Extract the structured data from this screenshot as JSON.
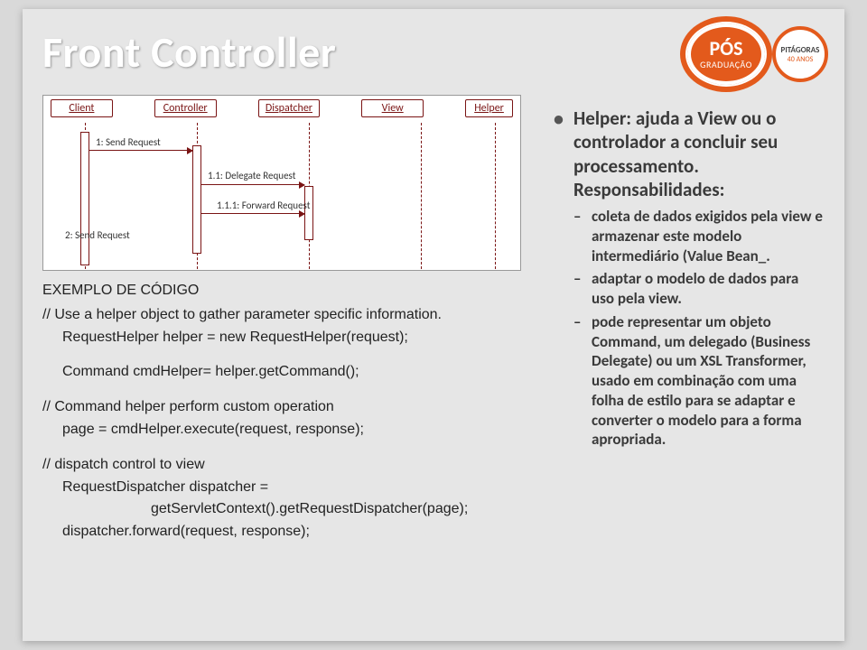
{
  "title": "Front Controller",
  "badge": {
    "pos": "PÓS",
    "grad": "GRADUAÇÃO",
    "pit": "PITÁGORAS",
    "pitSub": "40 ANOS"
  },
  "diagram": {
    "objects": [
      "Client",
      "Controller",
      "Dispatcher",
      "View",
      "Helper"
    ],
    "msg1": "1: Send Request",
    "msg2": "1.1: Delegate Request",
    "msg3": "1.1.1: Forward Request",
    "msg4": "2: Send Request"
  },
  "code": {
    "heading": "EXEMPLO DE CÓDIGO",
    "l1": "// Use a helper object to gather parameter specific information.",
    "l2": "RequestHelper helper = new RequestHelper(request);",
    "l3": "Command cmdHelper= helper.getCommand();",
    "l4": "// Command helper perform custom operation",
    "l5": "page = cmdHelper.execute(request, response);",
    "l6": "// dispatch control to view",
    "l7": "RequestDispatcher dispatcher =",
    "l8": "getServletContext().getRequestDispatcher(page);",
    "l9": "dispatcher.forward(request, response);"
  },
  "right": {
    "lead": "Helper: ajuda a View ou o controlador a concluir seu processamento. Responsabilidades:",
    "items": [
      "coleta de dados exigidos pela view e armazenar este modelo intermediário (Value Bean_.",
      "adaptar o modelo de dados para uso pela view.",
      "pode representar um objeto Command, um delegado (Business Delegate) ou um XSL Transformer, usado em combinação com uma folha de estilo para se adaptar e converter o modelo para a forma apropriada."
    ]
  }
}
